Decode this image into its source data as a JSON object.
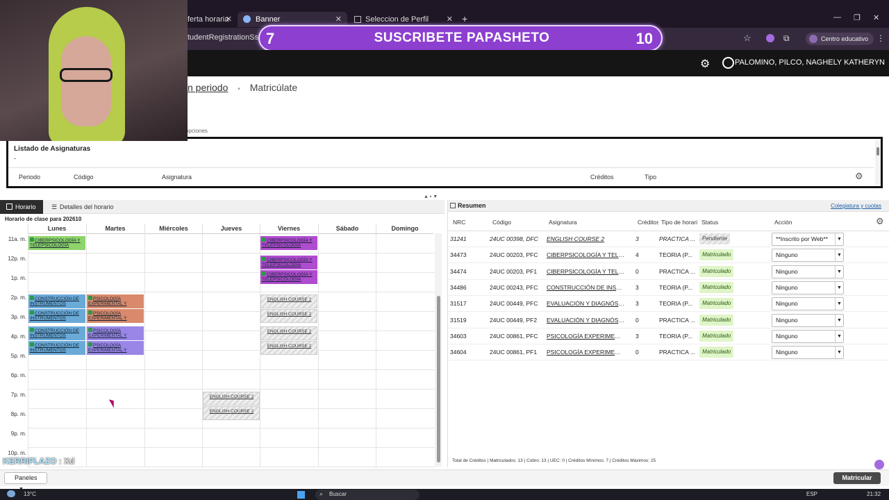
{
  "browser": {
    "tabs": [
      {
        "label": "ferta horaria"
      },
      {
        "label": "Banner"
      },
      {
        "label": "Seleccion de Perfil"
      }
    ],
    "url": "tudentRegistrationSsb/ss",
    "centro_label": "Centro educativo"
  },
  "overlay": {
    "left_num": "7",
    "text": "SUSCRIBETE PAPASHETO",
    "right_num": "10",
    "chat_user": "KERRIFLAZO",
    "chat_msg": ": Xd"
  },
  "header": {
    "user": "PALOMINO, PILCO, NAGHELY KATHERYN"
  },
  "breadcrumb": {
    "link": "n periodo",
    "sep": "•",
    "current": "Matricúlate"
  },
  "subnote": "o y opciones",
  "listado": {
    "title": "Listado de Asignaturas",
    "dash": "-",
    "headers": [
      "Periodo",
      "Código",
      "Asignatura",
      "Créditos",
      "Tipo"
    ]
  },
  "schedule": {
    "tab_horario": "Horario",
    "tab_detalles": "Detalles del horario",
    "title": "Horario de clase para 202610",
    "days": [
      "Lunes",
      "Martes",
      "Miércoles",
      "Jueves",
      "Viernes",
      "Sábado",
      "Domingo"
    ],
    "hours": [
      "11a. m.",
      "12p. m.",
      "1p. m.",
      "2p. m.",
      "3p. m.",
      "4p. m.",
      "5p. m.",
      "6p. m.",
      "7p. m.",
      "8p. m.",
      "9p. m.",
      "10p. m."
    ],
    "events": [
      {
        "label": "CIBERPSICOLOGÍA Y TELEPSICOLOGÍA",
        "day": 0,
        "start": 0,
        "color": "#8ed46a",
        "check": true
      },
      {
        "label": "CIBERPSICOLOGÍA Y TELEPSICOLOGÍA",
        "day": 4,
        "start": 0,
        "color": "#b04ccf",
        "check": true
      },
      {
        "label": "CIBERPSICOLOGÍA Y TELEPSICOLOGÍA",
        "day": 4,
        "start": 1,
        "color": "#b04ccf",
        "check": true
      },
      {
        "label": "CIBERPSICOLOGÍA Y TELEPSICOLOGÍA",
        "day": 4,
        "start": 1.75,
        "color": "#b04ccf",
        "check": true
      },
      {
        "label": "CONSTRUCCIÓN DE INSTRUMENTOS",
        "day": 0,
        "start": 3,
        "color": "#6aaad8",
        "check": true
      },
      {
        "label": "CONSTRUCCIÓN DE INSTRUMENTOS",
        "day": 0,
        "start": 3.75,
        "color": "#6aaad8",
        "check": true
      },
      {
        "label": "PSICOLOGÍA EXPERIMENTAL Y",
        "day": 1,
        "start": 3,
        "color": "#d98a6c",
        "check": true
      },
      {
        "label": "PSICOLOGÍA EXPERIMENTAL Y",
        "day": 1,
        "start": 3.75,
        "color": "#d98a6c",
        "check": true
      },
      {
        "label": "CONSTRUCCIÓN DE INSTRUMENTOS",
        "day": 0,
        "start": 4.65,
        "color": "#6aaad8",
        "check": true
      },
      {
        "label": "CONSTRUCCIÓN DE INSTRUMENTOS",
        "day": 0,
        "start": 5.4,
        "color": "#6aaad8",
        "check": true
      },
      {
        "label": "PSICOLOGÍA EXPERIMENTAL Y",
        "day": 1,
        "start": 4.65,
        "color": "#9a86e6",
        "check": true
      },
      {
        "label": "PSICOLOGÍA EXPERIMENTAL Y",
        "day": 1,
        "start": 5.4,
        "color": "#9a86e6",
        "check": true
      },
      {
        "label": "ENGLISH COURSE 2",
        "day": 4,
        "start": 3,
        "color": "",
        "check": false
      },
      {
        "label": "ENGLISH COURSE 2",
        "day": 4,
        "start": 3.75,
        "color": "",
        "check": false
      },
      {
        "label": "ENGLISH COURSE 2",
        "day": 4,
        "start": 4.65,
        "color": "",
        "check": false
      },
      {
        "label": "ENGLISH COURSE 2",
        "day": 4,
        "start": 5.4,
        "color": "",
        "check": false
      },
      {
        "label": "ENGLISH COURSE 2",
        "day": 3,
        "start": 8,
        "color": "",
        "check": false
      },
      {
        "label": "ENGLISH COURSE 2",
        "day": 3,
        "start": 8.75,
        "color": "",
        "check": false
      }
    ]
  },
  "resumen": {
    "title": "Resumen",
    "link": "Colegiatura y cuotas",
    "headers": [
      "NRC",
      "Código",
      "Asignatura",
      "Créditos",
      "Tipo de horario",
      "Status",
      "Acción"
    ],
    "rows": [
      {
        "nrc": "31241",
        "codigo": "24UC 00398, DFC",
        "asignatura": "ENGLISH COURSE 2",
        "creditos": "3",
        "tipo": "PRACTICA ...",
        "status": "Pendiente",
        "accion": "**Inscrito por Web**"
      },
      {
        "nrc": "34473",
        "codigo": "24UC 00203, PFC",
        "asignatura": "CIBERPSICOLOGÍA Y TELEP...",
        "creditos": "4",
        "tipo": "TEORIA (P...",
        "status": "Matriculado",
        "accion": "Ninguno"
      },
      {
        "nrc": "34474",
        "codigo": "24UC 00203, PF1",
        "asignatura": "CIBERPSICOLOGÍA Y TELEP...",
        "creditos": "0",
        "tipo": "PRACTICA ...",
        "status": "Matriculado",
        "accion": "Ninguno"
      },
      {
        "nrc": "34486",
        "codigo": "24UC 00243, PFC",
        "asignatura": "CONSTRUCCIÓN DE INSTRU...",
        "creditos": "3",
        "tipo": "TEORIA (P...",
        "status": "Matriculado",
        "accion": "Ninguno"
      },
      {
        "nrc": "31517",
        "codigo": "24UC 00449, PFC",
        "asignatura": "EVALUACIÓN Y DIAGNÓSTIC...",
        "creditos": "3",
        "tipo": "TEORIA (P...",
        "status": "Matriculado",
        "accion": "Ninguno"
      },
      {
        "nrc": "31519",
        "codigo": "24UC 00449, PF2",
        "asignatura": "EVALUACIÓN Y DIAGNÓSTIC...",
        "creditos": "0",
        "tipo": "PRACTICA ...",
        "status": "Matriculado",
        "accion": "Ninguno"
      },
      {
        "nrc": "34603",
        "codigo": "24UC 00861, PFC",
        "asignatura": "PSICOLOGÍA EXPERIMENTAL...",
        "creditos": "3",
        "tipo": "TEORIA (P...",
        "status": "Matriculado",
        "accion": "Ninguno"
      },
      {
        "nrc": "34604",
        "codigo": "24UC 00861, PF1",
        "asignatura": "PSICOLOGÍA EXPERIMENTAL...",
        "creditos": "0",
        "tipo": "PRACTICA ...",
        "status": "Matriculado",
        "accion": "Ninguno"
      }
    ],
    "totals": "Total de Créditos | Matriculados: 13 | Cobro: 13 | UEC: 0 | Créditos Mínimos: 7 | Créditos Máximos: 25"
  },
  "bottom": {
    "paneles": "Paneles",
    "matricular": "Matricular"
  },
  "taskbar": {
    "temp": "13°C",
    "search": "Buscar",
    "lang": "ESP",
    "time": "21:32"
  }
}
